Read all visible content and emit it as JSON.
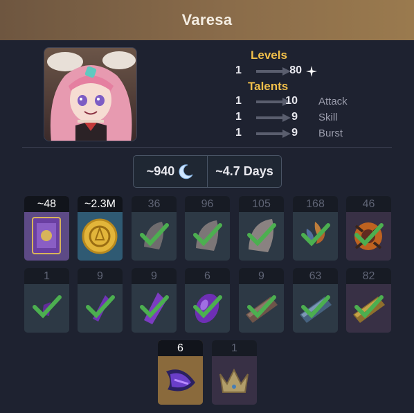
{
  "header": {
    "title": "Varesa"
  },
  "levels": {
    "title": "Levels",
    "from": "1",
    "to": "80"
  },
  "talents": {
    "title": "Talents",
    "rows": [
      {
        "from": "1",
        "to": "10",
        "label": "Attack"
      },
      {
        "from": "1",
        "to": "9",
        "label": "Skill"
      },
      {
        "from": "1",
        "to": "9",
        "label": "Burst"
      }
    ]
  },
  "summary": {
    "resin": "~940",
    "days": "~4.7 Days"
  },
  "materials": {
    "row1": [
      {
        "count": "~48",
        "icon": "exp-book-icon",
        "state": "active",
        "bg": "purple"
      },
      {
        "count": "~2.3M",
        "icon": "mora-coin-icon",
        "state": "active",
        "bg": "blue"
      },
      {
        "count": "36",
        "icon": "horn-gray-1-icon",
        "state": "done",
        "bg": "dark"
      },
      {
        "count": "96",
        "icon": "horn-gray-2-icon",
        "state": "done",
        "bg": "dark"
      },
      {
        "count": "105",
        "icon": "horn-gray-3-icon",
        "state": "done",
        "bg": "dark"
      },
      {
        "count": "168",
        "icon": "flower-specialty-icon",
        "state": "done",
        "bg": "dark"
      },
      {
        "count": "46",
        "icon": "boss-core-icon",
        "state": "done",
        "bg": "dark"
      }
    ],
    "row2": [
      {
        "count": "1",
        "icon": "gem-sliver-icon",
        "state": "done",
        "bg": "dark"
      },
      {
        "count": "9",
        "icon": "gem-fragment-icon",
        "state": "done",
        "bg": "dark"
      },
      {
        "count": "9",
        "icon": "gem-chunk-icon",
        "state": "done",
        "bg": "dark"
      },
      {
        "count": "6",
        "icon": "gem-gemstone-icon",
        "state": "done",
        "bg": "dark"
      },
      {
        "count": "9",
        "icon": "talent-book-1-icon",
        "state": "done",
        "bg": "dark"
      },
      {
        "count": "63",
        "icon": "talent-book-2-icon",
        "state": "done",
        "bg": "dark"
      },
      {
        "count": "82",
        "icon": "talent-book-3-icon",
        "state": "done",
        "bg": "dark"
      }
    ],
    "row3": [
      {
        "count": "6",
        "icon": "weekly-boss-drop-icon",
        "state": "active",
        "bg": "orange"
      },
      {
        "count": "1",
        "icon": "crown-of-insight-icon",
        "state": "done",
        "bg": "dark"
      }
    ]
  },
  "colors": {
    "accent": "#f2c04a",
    "check": "#4caf50",
    "background": "#1e2230"
  }
}
